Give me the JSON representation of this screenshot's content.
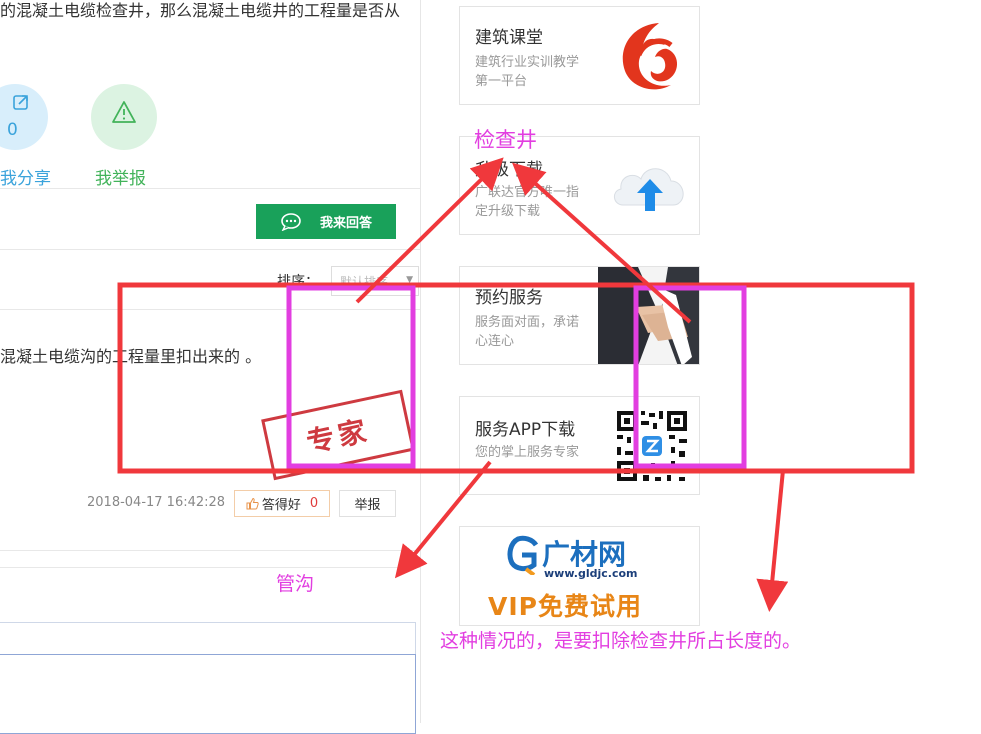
{
  "question": {
    "text": "的混凝土电缆检查井，那么混凝土电缆井的工程量是否从"
  },
  "actions": {
    "share_count": "0",
    "share_label": "我分享",
    "report_label": "我举报"
  },
  "answer_button": {
    "label": "我来回答"
  },
  "sort": {
    "label": "排序：",
    "selected": "默认排序"
  },
  "answer": {
    "text": "混凝土电缆沟的工程量里扣出来的 。",
    "stamp_text": "专家",
    "date": "2018-04-17 16:42:28",
    "good_label": "答得好",
    "good_count": "0",
    "report_label": "举报"
  },
  "sidebar": {
    "cards": [
      {
        "title": "建筑课堂",
        "desc": "建筑行业实训教学第一平台"
      },
      {
        "title": "升级下载",
        "desc": "广联达官方唯一指定升级下载"
      },
      {
        "title": "预约服务",
        "desc": "服务面对面，承诺心连心"
      },
      {
        "title": "服务APP下载",
        "desc": "您的掌上服务专家"
      }
    ],
    "gldjc": {
      "brand": "广材网",
      "url": "www.gldjc.com",
      "promo": "VIP免费试用"
    }
  },
  "annotations": {
    "label_inspection_well": "检查井",
    "label_pipe_trench": "管沟",
    "note": "这种情况的，是要扣除检查井所占长度的。"
  },
  "colors": {
    "annotation_red": "#f0383c",
    "annotation_magenta": "#e23ee0",
    "answer_green": "#19a15a",
    "share_blue": "#3aa3db",
    "report_green": "#42b35a"
  }
}
